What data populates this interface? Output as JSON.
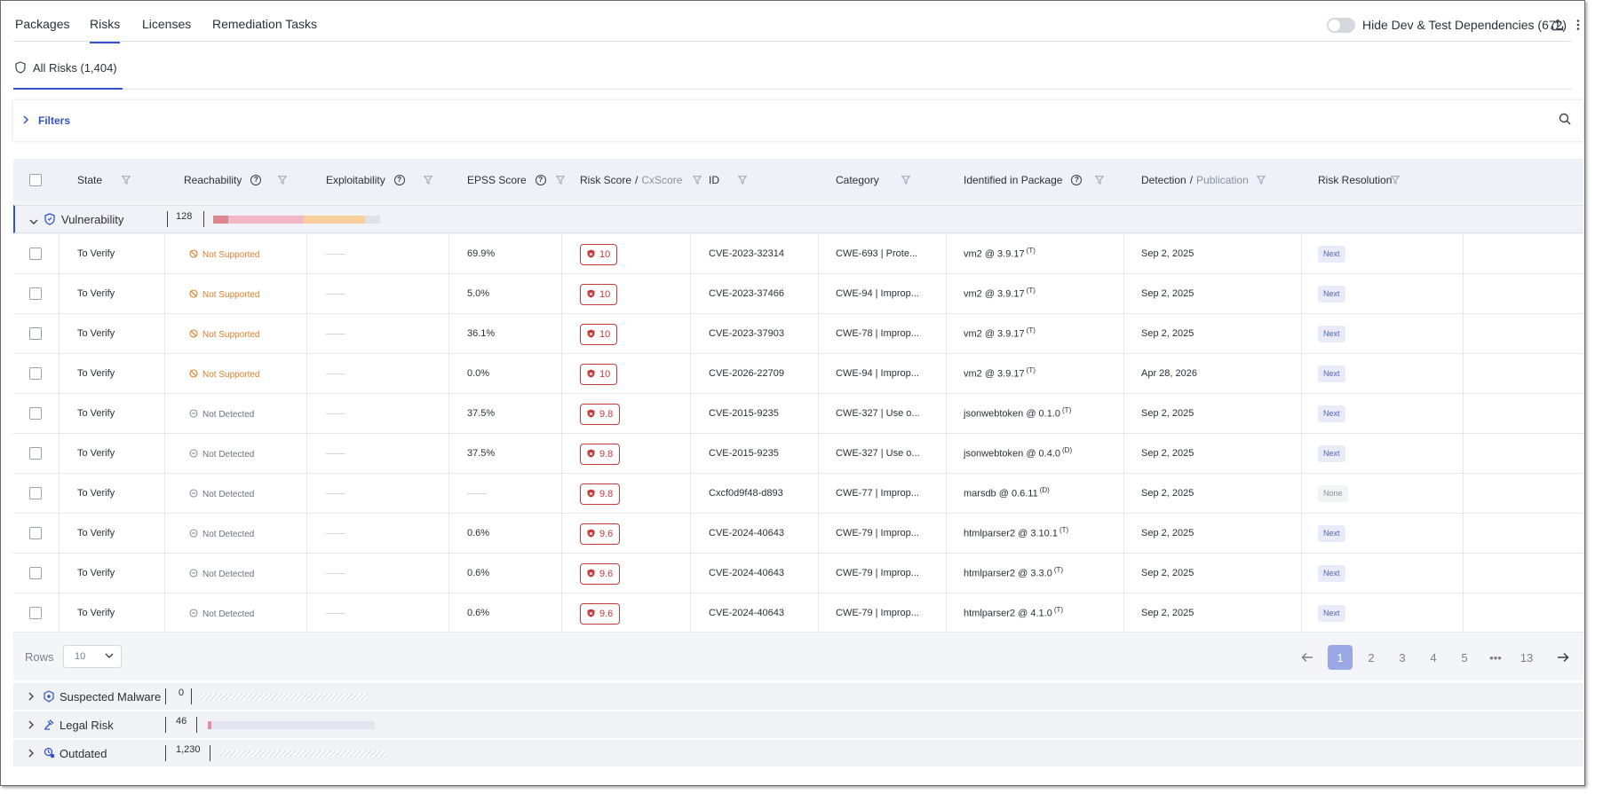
{
  "top_tabs": {
    "packages": "Packages",
    "risks": "Risks",
    "licenses": "Licenses",
    "remediation": "Remediation Tasks"
  },
  "hide_dev_label": "Hide Dev & Test Dependencies (672)",
  "sub_tab": "All Risks (1,404)",
  "filters_label": "Filters",
  "columns": {
    "state": "State",
    "reachability": "Reachability",
    "exploitability": "Exploitability",
    "epss": "EPSS Score",
    "risk_score": "Risk Score",
    "cx_score": "CxScore",
    "id": "ID",
    "category": "Category",
    "identified_in": "Identified in Package",
    "detection": "Detection",
    "publication": "Publication",
    "resolution": "Risk Resolution",
    "slash": "/"
  },
  "vulnerability_group": {
    "label": "Vulnerability",
    "count": "128",
    "severity_bar": {
      "critical": 0.08,
      "high": 0.41,
      "medium": 0.33,
      "low": 0.08
    }
  },
  "rows": [
    {
      "state": "To Verify",
      "reach": "Not Supported",
      "reach_type": "ns",
      "epss": "69.9%",
      "score": "10",
      "id": "CVE-2023-32314",
      "category": "CWE-693 | Prote...",
      "pkg": "vm2 @ 3.9.17",
      "pkg_tag": "(T)",
      "date": "Sep 2, 2025",
      "res": "Next"
    },
    {
      "state": "To Verify",
      "reach": "Not Supported",
      "reach_type": "ns",
      "epss": "5.0%",
      "score": "10",
      "id": "CVE-2023-37466",
      "category": "CWE-94 | Improp...",
      "pkg": "vm2 @ 3.9.17",
      "pkg_tag": "(T)",
      "date": "Sep 2, 2025",
      "res": "Next"
    },
    {
      "state": "To Verify",
      "reach": "Not Supported",
      "reach_type": "ns",
      "epss": "36.1%",
      "score": "10",
      "id": "CVE-2023-37903",
      "category": "CWE-78 | Improp...",
      "pkg": "vm2 @ 3.9.17",
      "pkg_tag": "(T)",
      "date": "Sep 2, 2025",
      "res": "Next"
    },
    {
      "state": "To Verify",
      "reach": "Not Supported",
      "reach_type": "ns",
      "epss": "0.0%",
      "score": "10",
      "id": "CVE-2026-22709",
      "category": "CWE-94 | Improp...",
      "pkg": "vm2 @ 3.9.17",
      "pkg_tag": "(T)",
      "date": "Apr 28, 2026",
      "res": "Next"
    },
    {
      "state": "To Verify",
      "reach": "Not Detected",
      "reach_type": "nd",
      "epss": "37.5%",
      "score": "9.8",
      "id": "CVE-2015-9235",
      "category": "CWE-327 | Use o...",
      "pkg": "jsonwebtoken @ 0.1.0",
      "pkg_tag": "(T)",
      "date": "Sep 2, 2025",
      "res": "Next"
    },
    {
      "state": "To Verify",
      "reach": "Not Detected",
      "reach_type": "nd",
      "epss": "37.5%",
      "score": "9.8",
      "id": "CVE-2015-9235",
      "category": "CWE-327 | Use o...",
      "pkg": "jsonwebtoken @ 0.4.0",
      "pkg_tag": "(D)",
      "date": "Sep 2, 2025",
      "res": "Next"
    },
    {
      "state": "To Verify",
      "reach": "Not Detected",
      "reach_type": "nd",
      "epss": "",
      "score": "9.8",
      "id": "Cxcf0d9f48-d893",
      "category": "CWE-77 | Improp...",
      "pkg": "marsdb @ 0.6.11",
      "pkg_tag": "(D)",
      "date": "Sep 2, 2025",
      "res": "None"
    },
    {
      "state": "To Verify",
      "reach": "Not Detected",
      "reach_type": "nd",
      "epss": "0.6%",
      "score": "9.6",
      "id": "CVE-2024-40643",
      "category": "CWE-79 | Improp...",
      "pkg": "htmlparser2 @ 3.10.1",
      "pkg_tag": "(T)",
      "date": "Sep 2, 2025",
      "res": "Next"
    },
    {
      "state": "To Verify",
      "reach": "Not Detected",
      "reach_type": "nd",
      "epss": "0.6%",
      "score": "9.6",
      "id": "CVE-2024-40643",
      "category": "CWE-79 | Improp...",
      "pkg": "htmlparser2 @ 3.3.0",
      "pkg_tag": "(T)",
      "date": "Sep 2, 2025",
      "res": "Next"
    },
    {
      "state": "To Verify",
      "reach": "Not Detected",
      "reach_type": "nd",
      "epss": "0.6%",
      "score": "9.6",
      "id": "CVE-2024-40643",
      "category": "CWE-79 | Improp...",
      "pkg": "htmlparser2 @ 4.1.0",
      "pkg_tag": "(T)",
      "date": "Sep 2, 2025",
      "res": "Next"
    }
  ],
  "pagination": {
    "rows_label": "Rows",
    "rows_value": "10",
    "pages": [
      "1",
      "2",
      "3",
      "4",
      "5",
      "•••",
      "13"
    ],
    "current": "1"
  },
  "collapsed_groups": [
    {
      "label": "Suspected Malware",
      "count": "0"
    },
    {
      "label": "Legal Risk",
      "count": "46"
    },
    {
      "label": "Outdated",
      "count": "1,230"
    }
  ],
  "colors": {
    "accent": "#3153c9",
    "critical": "#d9888f",
    "high": "#f2b8c5",
    "medium": "#f8cf9c",
    "low": "#dfe2ea",
    "risk": "#c53a3a",
    "not_supported": "#e07f2a"
  }
}
